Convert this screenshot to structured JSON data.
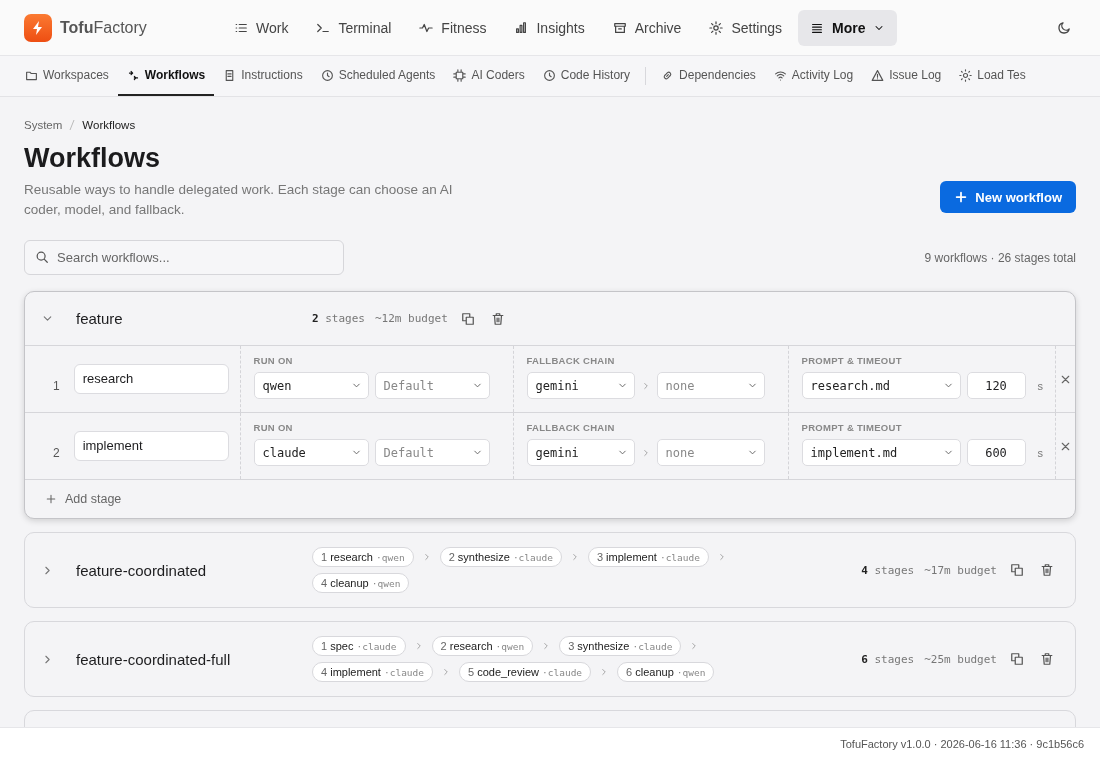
{
  "brand": {
    "name": "**Tofu**Factory"
  },
  "nav": [
    {
      "label": "Work",
      "selected": false
    },
    {
      "label": "Terminal",
      "selected": false
    },
    {
      "label": "Fitness",
      "selected": false
    },
    {
      "label": "Insights",
      "selected": false
    },
    {
      "label": "Archive",
      "selected": false
    },
    {
      "label": "Settings",
      "selected": false
    },
    {
      "label": "More",
      "selected": true
    }
  ],
  "subnav": {
    "groups": [
      [
        {
          "label": "Workspaces",
          "selected": false
        },
        {
          "label": "Workflows",
          "selected": true
        },
        {
          "label": "Instructions",
          "selected": false
        },
        {
          "label": "Scheduled Agents",
          "selected": false
        },
        {
          "label": "AI Coders",
          "selected": false
        },
        {
          "label": "Code History",
          "selected": false
        }
      ],
      [
        {
          "label": "Dependencies",
          "selected": false
        },
        {
          "label": "Activity Log",
          "selected": false
        },
        {
          "label": "Issue Log",
          "selected": false
        },
        {
          "label": "Load Tes",
          "selected": false
        }
      ]
    ]
  },
  "breadcrumb": [
    "System",
    "Workflows"
  ],
  "title": "Workflows",
  "subtitle": "Reusable ways to handle delegated work. Each stage can choose an AI coder, model, and fallback.",
  "new_button": "New workflow",
  "search": {
    "placeholder": "Search workflows..."
  },
  "summary": "9 workflows · 26 stages total",
  "workflows": [
    {
      "name": "feature",
      "expanded": true,
      "stage_count": "2",
      "stage_word": "stages",
      "budget": "~12m budget",
      "stages": [
        {
          "index": "1",
          "name": "research",
          "run_on": {
            "label": "RUN ON",
            "coder": {
              "value": "qwen",
              "dimmed": false
            },
            "model": {
              "value": "Default",
              "dimmed": true
            }
          },
          "fallback": {
            "label": "FALLBACK CHAIN",
            "chain": [
              {
                "value": "gemini",
                "dimmed": false
              },
              {
                "value": "none",
                "dimmed": true
              }
            ]
          },
          "prompt": {
            "label": "PROMPT & TIMEOUT",
            "file": "research.md",
            "timeout": "120",
            "unit": "s"
          }
        },
        {
          "index": "2",
          "name": "implement",
          "run_on": {
            "label": "RUN ON",
            "coder": {
              "value": "claude",
              "dimmed": false
            },
            "model": {
              "value": "Default",
              "dimmed": true
            }
          },
          "fallback": {
            "label": "FALLBACK CHAIN",
            "chain": [
              {
                "value": "gemini",
                "dimmed": false
              },
              {
                "value": "none",
                "dimmed": true
              }
            ]
          },
          "prompt": {
            "label": "PROMPT & TIMEOUT",
            "file": "implement.md",
            "timeout": "600",
            "unit": "s"
          }
        }
      ],
      "add_stage": "Add stage"
    },
    {
      "name": "feature-coordinated",
      "expanded": false,
      "stage_count": "4",
      "stage_word": "stages",
      "budget": "~17m budget",
      "chips": [
        {
          "num": "1",
          "name": "research",
          "coder": "·qwen"
        },
        {
          "num": "2",
          "name": "synthesize",
          "coder": "·claude"
        },
        {
          "num": "3",
          "name": "implement",
          "coder": "·claude"
        },
        {
          "num": "4",
          "name": "cleanup",
          "coder": "·qwen"
        }
      ]
    },
    {
      "name": "feature-coordinated-full",
      "expanded": false,
      "stage_count": "6",
      "stage_word": "stages",
      "budget": "~25m budget",
      "chips": [
        {
          "num": "1",
          "name": "spec",
          "coder": "·claude"
        },
        {
          "num": "2",
          "name": "research",
          "coder": "·qwen"
        },
        {
          "num": "3",
          "name": "synthesize",
          "coder": "·claude"
        },
        {
          "num": "4",
          "name": "implement",
          "coder": "·claude"
        },
        {
          "num": "5",
          "name": "code_review",
          "coder": "·claude"
        },
        {
          "num": "6",
          "name": "cleanup",
          "coder": "·qwen"
        }
      ]
    }
  ],
  "footer": "TofuFactory v1.0.0 · 2026-06-16 11:36 · 9c1b56c6"
}
